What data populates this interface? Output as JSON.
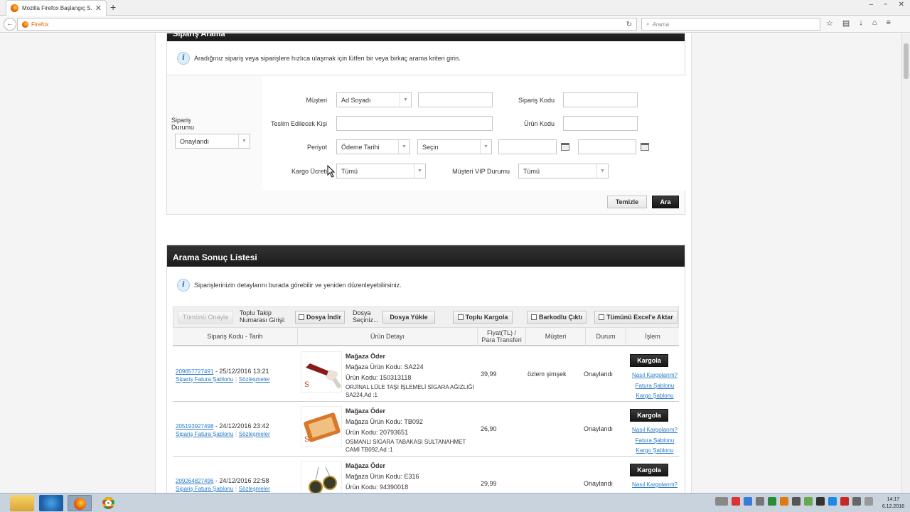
{
  "browser": {
    "tab_title": "Mozilla Firefox Başlangıç S...",
    "url_brand": "Firefox",
    "search_placeholder": "Arama"
  },
  "search_panel": {
    "header": "Sipariş Arama",
    "info": "Aradığınız sipariş veya siparişlere hızlıca ulaşmak için lütfen bir veya birkaç arama kriteri girin.",
    "status_label": "Sipariş Durumu",
    "status_value": "Onaylandı",
    "customer_label": "Müşteri",
    "customer_type": "Ad Soyadı",
    "order_code_label": "Sipariş Kodu",
    "recipient_label": "Teslim Edilecek Kişi",
    "product_code_label": "Ürün Kodu",
    "period_label": "Periyot",
    "period_type": "Ödeme Tarihi",
    "period_choice": "Seçin",
    "shipping_fee_label": "Kargo Ücreti",
    "shipping_fee_value": "Tümü",
    "vip_label": "Müşteri VIP Durumu",
    "vip_value": "Tümü",
    "clear_button": "Temizle",
    "search_button": "Ara"
  },
  "results_panel": {
    "header": "Arama Sonuç Listesi",
    "info": "Siparişlerinizin detaylarını burada görebilir ve yeniden düzenleyebilirsiniz.",
    "toolbar": {
      "approve_all": "Tümünü Onayla",
      "bulk_tracking": "Toplu Takip Numarası Girişi:",
      "download_file": "Dosya İndir",
      "select_file": "Dosya Seçiniz...",
      "upload_file": "Dosya Yükle",
      "bulk_ship": "Toplu Kargola",
      "barcode_print": "Barkodlu Çıktı",
      "export_excel": "Tümünü Excel'e Aktar"
    },
    "columns": [
      "Sipariş Kodu - Tarih",
      "Ürün Detayı",
      "Fiyat(TL) / Para Transferi",
      "Müşteri",
      "Durum",
      "İşlem"
    ],
    "rows": [
      {
        "code": "209657727491",
        "date": "- 25/12/2016 13:21",
        "invoice_link": "Sipariş Fatura Şablonu",
        "contracts_link": "Sözleşmeler",
        "payer": "Mağaza Öder",
        "store_code": "Mağaza Ürün Kodu: SA224",
        "product_code": "Ürün Kodu: 150313118",
        "product_name": "ORJİNAL LÜLE TAŞI İŞLEMELİ SİGARA AĞIZLIĞI SA224,Ad :1",
        "price": "39,99",
        "customer": "özlem şimşek",
        "status": "Onaylandı",
        "ship_button": "Kargola",
        "how_link": "Nasıl Kargolarım?",
        "invoice_tpl_link": "Fatura Şablonu",
        "cargo_tpl_link": "Kargo Şablonu"
      },
      {
        "code": "205193927498",
        "date": "- 24/12/2016 23:42",
        "invoice_link": "Sipariş Fatura Şablonu",
        "contracts_link": "Sözleşmeler",
        "payer": "Mağaza Öder",
        "store_code": "Mağaza Ürün Kodu: TB092",
        "product_code": "Ürün Kodu: 20793651",
        "product_name": "OSMANLI SİGARA TABAKASI SULTANAHMET CAMİ TB092,Ad :1",
        "price": "26,90",
        "customer": "",
        "status": "Onaylandı",
        "ship_button": "Kargola",
        "how_link": "Nasıl Kargolarım?",
        "invoice_tpl_link": "Fatura Şablonu",
        "cargo_tpl_link": "Kargo Şablonu"
      },
      {
        "code": "209264827496",
        "date": "- 24/12/2016 22:58",
        "invoice_link": "Sipariş Fatura Şablonu",
        "contracts_link": "Sözleşmeler",
        "payer": "Mağaza Öder",
        "store_code": "Mağaza Ürün Kodu: E316",
        "product_code": "Ürün Kodu: 94390018",
        "product_name": "",
        "price": "29,99",
        "customer": "",
        "status": "Onaylandı",
        "ship_button": "Kargola",
        "how_link": "Nasıl Kargolarım?",
        "invoice_tpl_link": "",
        "cargo_tpl_link": ""
      }
    ]
  },
  "taskbar": {
    "time": "14:17",
    "date": "6.12.2016"
  }
}
